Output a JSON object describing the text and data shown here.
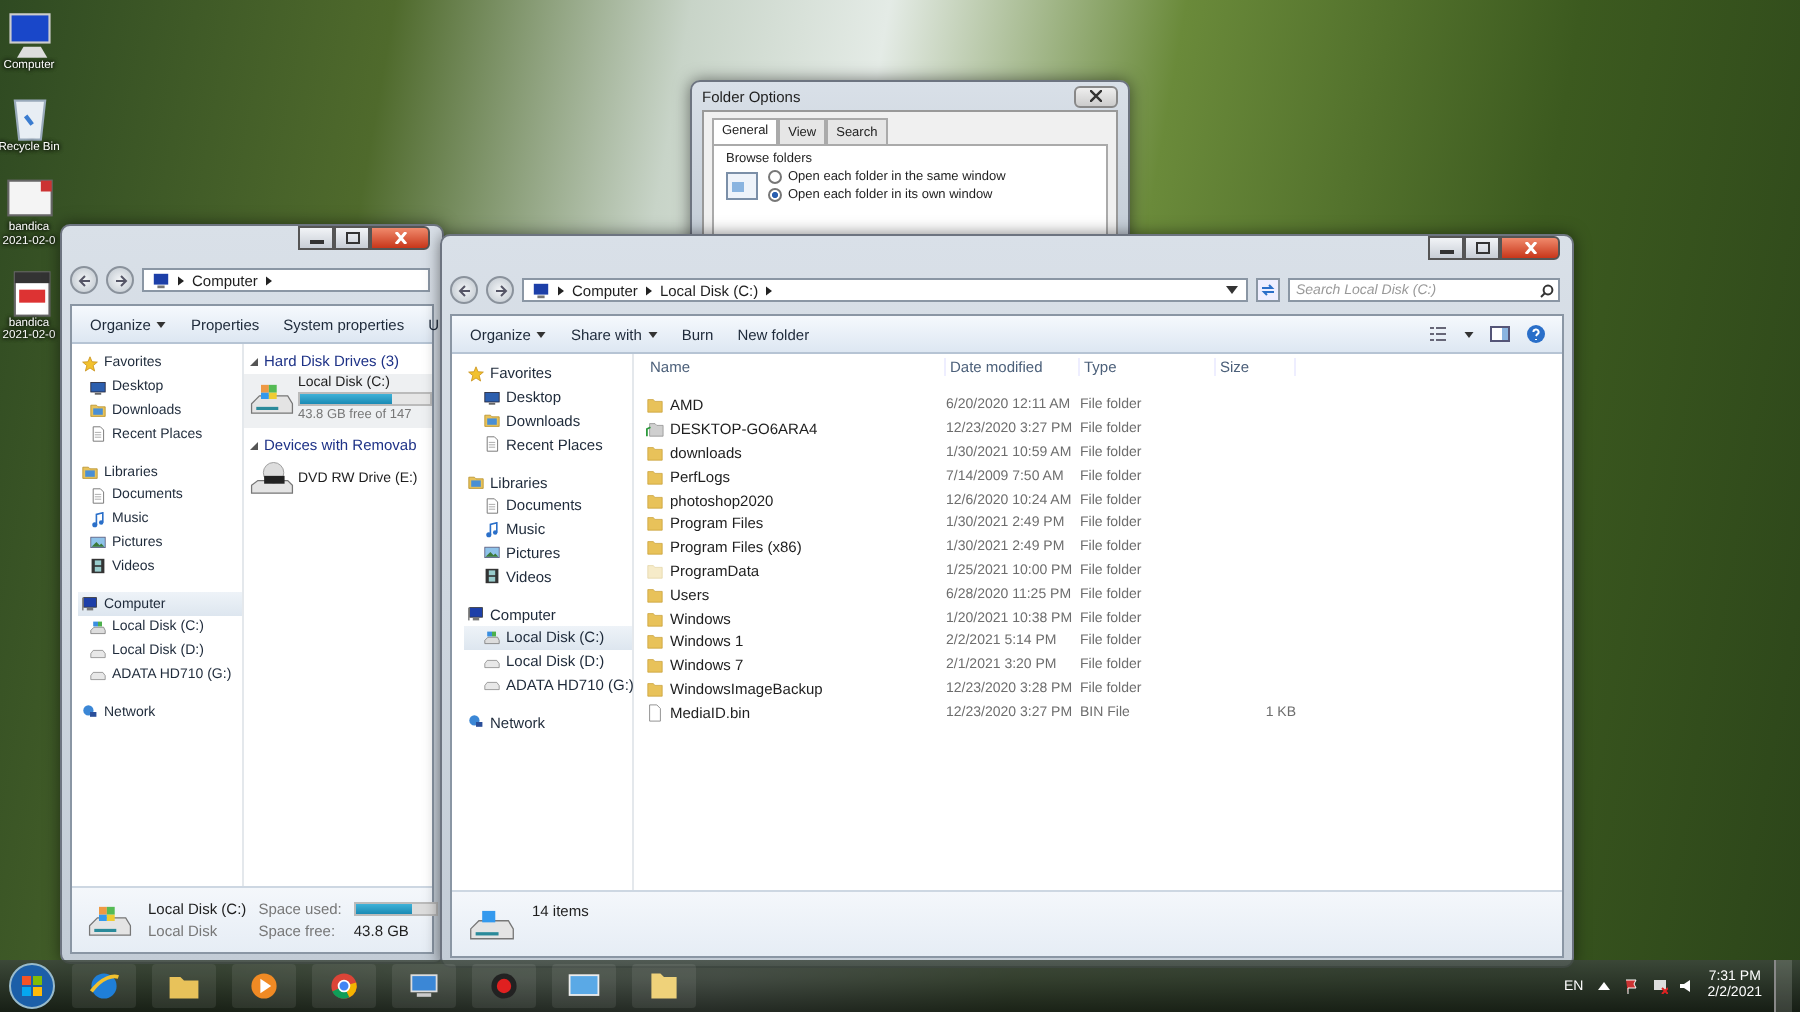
{
  "desktop": {
    "icons": [
      {
        "kind": "computer",
        "lines": [
          "Computer"
        ]
      },
      {
        "kind": "recycle-bin",
        "lines": [
          "Recycle Bin"
        ]
      },
      {
        "kind": "video",
        "lines": [
          "bandica",
          "2021-02-0"
        ]
      },
      {
        "kind": "video-file",
        "lines": [
          "bandica",
          "2021-02-0"
        ]
      }
    ]
  },
  "folder_options": {
    "title": "Folder Options",
    "tabs": [
      {
        "label": "General",
        "selected": true
      },
      {
        "label": "View",
        "selected": false
      },
      {
        "label": "Search",
        "selected": false
      }
    ],
    "group": "Browse folders",
    "options": [
      {
        "label": "Open each folder in the same window",
        "selected": false
      },
      {
        "label": "Open each folder in its own window",
        "selected": true
      }
    ]
  },
  "back_window": {
    "breadcrumb": [
      "Computer"
    ],
    "toolbar": [
      {
        "label": "Organize",
        "dropdown": true
      },
      {
        "label": "Properties",
        "dropdown": false
      },
      {
        "label": "System properties",
        "dropdown": false
      },
      {
        "label": "U",
        "dropdown": false
      }
    ],
    "sidebar": [
      {
        "label": "Favorites",
        "kind": "favorites",
        "selected": false,
        "children": [
          {
            "label": "Desktop",
            "kind": "desktop",
            "selected": false
          },
          {
            "label": "Downloads",
            "kind": "downloads",
            "selected": false
          },
          {
            "label": "Recent Places",
            "kind": "recent",
            "selected": false
          }
        ]
      },
      {
        "label": "Libraries",
        "kind": "libraries",
        "selected": false,
        "children": [
          {
            "label": "Documents",
            "kind": "documents",
            "selected": false
          },
          {
            "label": "Music",
            "kind": "music",
            "selected": false
          },
          {
            "label": "Pictures",
            "kind": "pictures",
            "selected": false
          },
          {
            "label": "Videos",
            "kind": "videos",
            "selected": false
          }
        ]
      },
      {
        "label": "Computer",
        "kind": "computer",
        "selected": true,
        "children": [
          {
            "label": "Local Disk (C:)",
            "kind": "system-drive",
            "selected": false
          },
          {
            "label": "Local Disk (D:)",
            "kind": "drive",
            "selected": false
          },
          {
            "label": "ADATA HD710 (G:)",
            "kind": "drive",
            "selected": false
          }
        ]
      },
      {
        "label": "Network",
        "kind": "network",
        "selected": false
      }
    ],
    "sections": [
      {
        "title": "Hard Disk Drives (3)",
        "drives": [
          {
            "name": "Local Disk (C:)",
            "kind": "system-drive",
            "level": 0.7,
            "detail": "43.8 GB free of 147"
          }
        ]
      },
      {
        "title": "Devices with Removab",
        "drives": [
          {
            "name": "DVD RW Drive (E:)",
            "kind": "dvd"
          }
        ]
      }
    ],
    "details": {
      "name": "Local Disk (C:)",
      "type": "Local Disk",
      "used_label": "Space used:",
      "level": 0.7,
      "free_label": "Space free:",
      "free": "43.8 GB"
    }
  },
  "main_window": {
    "breadcrumb": [
      "Computer",
      "Local Disk (C:)"
    ],
    "search": {
      "placeholder": "Search Local Disk (C:)"
    },
    "toolbar": [
      {
        "label": "Organize",
        "dropdown": true
      },
      {
        "label": "Share with",
        "dropdown": true
      },
      {
        "label": "Burn",
        "dropdown": false
      },
      {
        "label": "New folder",
        "dropdown": false
      }
    ],
    "sidebar": [
      {
        "label": "Favorites",
        "kind": "favorites",
        "selected": false,
        "children": [
          {
            "label": "Desktop",
            "kind": "desktop",
            "selected": false
          },
          {
            "label": "Downloads",
            "kind": "downloads",
            "selected": false
          },
          {
            "label": "Recent Places",
            "kind": "recent",
            "selected": false
          }
        ]
      },
      {
        "label": "Libraries",
        "kind": "libraries",
        "selected": false,
        "children": [
          {
            "label": "Documents",
            "kind": "documents",
            "selected": false
          },
          {
            "label": "Music",
            "kind": "music",
            "selected": false
          },
          {
            "label": "Pictures",
            "kind": "pictures",
            "selected": false
          },
          {
            "label": "Videos",
            "kind": "videos",
            "selected": false
          }
        ]
      },
      {
        "label": "Computer",
        "kind": "computer",
        "selected": false,
        "children": [
          {
            "label": "Local Disk (C:)",
            "kind": "system-drive",
            "selected": true
          },
          {
            "label": "Local Disk (D:)",
            "kind": "drive",
            "selected": false
          },
          {
            "label": "ADATA HD710 (G:)",
            "kind": "drive",
            "selected": false
          }
        ]
      },
      {
        "label": "Network",
        "kind": "network",
        "selected": false
      }
    ],
    "columns": [
      "Name",
      "Date modified",
      "Type",
      "Size"
    ],
    "rows": [
      {
        "kind": "folder",
        "name": "AMD",
        "date": "6/20/2020 12:11 AM",
        "type": "File folder"
      },
      {
        "kind": "shared-folder",
        "name": "DESKTOP-GO6ARA4",
        "date": "12/23/2020 3:27 PM",
        "type": "File folder"
      },
      {
        "kind": "folder",
        "name": "downloads",
        "date": "1/30/2021 10:59 AM",
        "type": "File folder"
      },
      {
        "kind": "folder",
        "name": "PerfLogs",
        "date": "7/14/2009 7:50 AM",
        "type": "File folder"
      },
      {
        "kind": "folder",
        "name": "photoshop2020",
        "date": "12/6/2020 10:24 AM",
        "type": "File folder"
      },
      {
        "kind": "folder",
        "name": "Program Files",
        "date": "1/30/2021 2:49 PM",
        "type": "File folder"
      },
      {
        "kind": "folder",
        "name": "Program Files (x86)",
        "date": "1/30/2021 2:49 PM",
        "type": "File folder"
      },
      {
        "kind": "hidden-folder",
        "name": "ProgramData",
        "date": "1/25/2021 10:00 PM",
        "type": "File folder"
      },
      {
        "kind": "folder",
        "name": "Users",
        "date": "6/28/2020 11:25 PM",
        "type": "File folder"
      },
      {
        "kind": "folder",
        "name": "Windows",
        "date": "1/20/2021 10:38 PM",
        "type": "File folder"
      },
      {
        "kind": "folder",
        "name": "Windows 1",
        "date": "2/2/2021 5:14 PM",
        "type": "File folder"
      },
      {
        "kind": "folder",
        "name": "Windows 7",
        "date": "2/1/2021 3:20 PM",
        "type": "File folder"
      },
      {
        "kind": "folder",
        "name": "WindowsImageBackup",
        "date": "12/23/2020 3:28 PM",
        "type": "File folder"
      },
      {
        "kind": "file",
        "name": "MediaID.bin",
        "date": "12/23/2020 3:27 PM",
        "type": "BIN File",
        "size": "1 KB"
      }
    ],
    "status": "14 items"
  },
  "taskbar": {
    "apps": [
      {
        "kind": "browser"
      },
      {
        "kind": "explorer"
      },
      {
        "kind": "media-player"
      },
      {
        "kind": "chrome"
      },
      {
        "kind": "network-app"
      },
      {
        "kind": "recorder"
      },
      {
        "kind": "monitor"
      },
      {
        "kind": "folder"
      }
    ],
    "language": "EN",
    "time": "7:31 PM",
    "date": "2/2/2021"
  }
}
